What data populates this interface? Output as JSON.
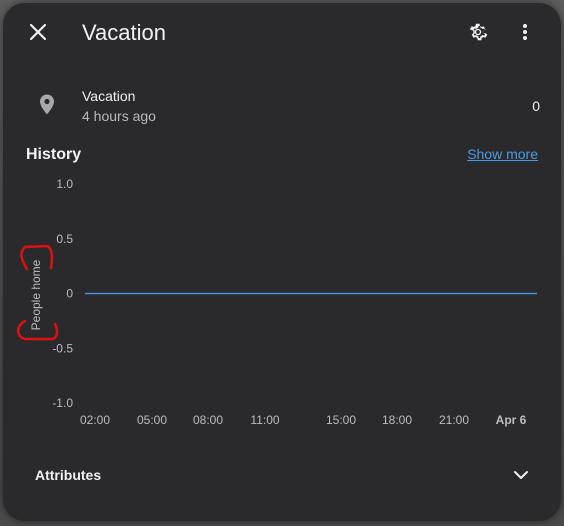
{
  "dialog": {
    "title": "Vacation",
    "icons": {
      "close": "close-icon",
      "settings": "gear-icon",
      "more": "more-vert-icon"
    }
  },
  "entity": {
    "icon": "map-marker-icon",
    "name": "Vacation",
    "last_changed": "4 hours ago",
    "state": "0"
  },
  "history": {
    "title": "History",
    "show_more": "Show more"
  },
  "chart_data": {
    "type": "line",
    "ylabel": "People home",
    "yticks": [
      "1.0",
      "0.5",
      "0",
      "-0.5",
      "-1.0"
    ],
    "ylim": [
      -1.0,
      1.0
    ],
    "xticks": [
      "02:00",
      "05:00",
      "08:00",
      "11:00",
      "15:00",
      "18:00",
      "21:00",
      "Apr 6"
    ],
    "series": [
      {
        "values": [
          0,
          0,
          0,
          0,
          0,
          0,
          0,
          0
        ]
      }
    ],
    "line_color": "#4a90d9",
    "grid": false
  },
  "attributes": {
    "label": "Attributes",
    "icon": "chevron-down-icon"
  },
  "annotation": {
    "color": "#e01010"
  }
}
